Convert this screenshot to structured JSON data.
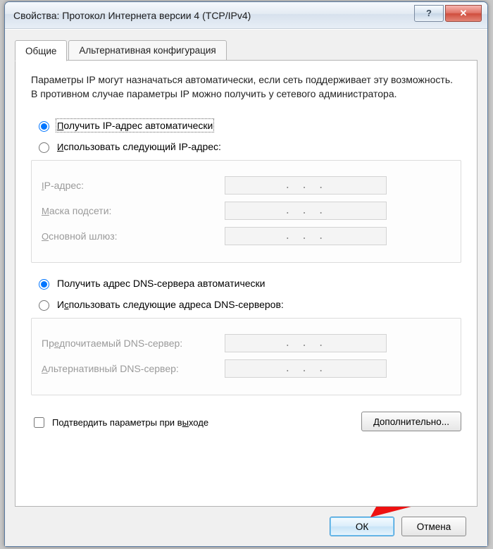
{
  "window": {
    "title": "Свойства: Протокол Интернета версии 4 (TCP/IPv4)",
    "help_tooltip": "?",
    "close_tooltip": "X"
  },
  "tabs": {
    "general": "Общие",
    "alternate": "Альтернативная конфигурация"
  },
  "intro_text": "Параметры IP могут назначаться автоматически, если сеть поддерживает эту возможность. В противном случае параметры IP можно получить у сетевого администратора.",
  "ip_section": {
    "auto_label": "Получить IP-адрес автоматически",
    "manual_label": "Использовать следующий IP-адрес:",
    "ip_label": "IP-адрес:",
    "mask_label": "Маска подсети:",
    "gateway_label": "Основной шлюз:"
  },
  "dns_section": {
    "auto_label": "Получить адрес DNS-сервера автоматически",
    "manual_label": "Использовать следующие адреса DNS-серверов:",
    "pref_label": "Предпочитаемый DNS-сервер:",
    "alt_label": "Альтернативный DNS-сервер:"
  },
  "validate_label": "Подтвердить параметры при выходе",
  "advanced_label": "Дополнительно...",
  "ok_label": "ОК",
  "cancel_label": "Отмена",
  "dots": ".   .   .",
  "colors": {
    "highlight": "#e11"
  }
}
